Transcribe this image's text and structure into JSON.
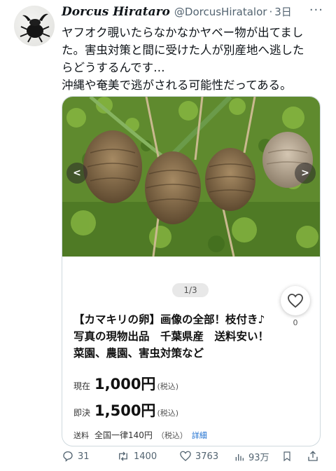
{
  "tweet": {
    "display_name": "Dorcus Hirataro",
    "handle": "@DorcusHiratalor",
    "separator": "·",
    "time": "3日",
    "more_icon": "more-horizontal-icon",
    "text_lines": [
      "ヤフオク覗いたらなかなかヤベー物が出てまし",
      "た。害虫対策と間に受けた人が別産地へ逃した",
      "らどうするんです…",
      "沖縄や奄美で逃がされる可能性だってある。"
    ]
  },
  "listing": {
    "image_counter": "1/3",
    "prev_icon": "chevron-left-icon",
    "next_icon": "chevron-right-icon",
    "like_count": "0",
    "title_lines": [
      "【カマキリの卵】画像の全部！枝付き♪",
      "写真の現物出品　千葉県産　送料安い！",
      "菜園、農園、害虫対策など"
    ],
    "current_price": {
      "label": "現在",
      "value": "1,000円",
      "tax": "(税込)"
    },
    "buyout_price": {
      "label": "即決",
      "value": "1,500円",
      "tax": "(税込)"
    },
    "shipping": {
      "label": "送料",
      "value": "全国一律140円",
      "tax": "（税込）",
      "link": "詳細"
    }
  },
  "actions": {
    "replies": "31",
    "retweets": "1400",
    "likes": "3763",
    "views": "93万"
  },
  "colors": {
    "text": "#0f1419",
    "secondary": "#536471",
    "border": "#cfd9de",
    "link": "#1d6fd0"
  }
}
